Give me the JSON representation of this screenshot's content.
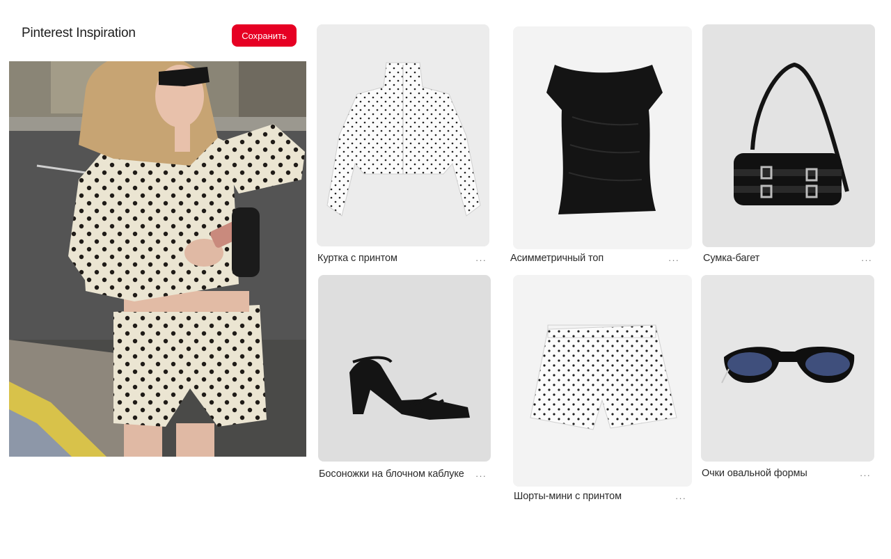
{
  "header": {
    "title": "Pinterest Inspiration",
    "save_label": "Сохранить"
  },
  "colors": {
    "accent": "#e60023",
    "card_bg_light": "#f3f3f3",
    "card_bg_grey": "#e4e4e4"
  },
  "hero": {
    "alt": "Look: polka dot jacket and shorts"
  },
  "products": [
    {
      "label": "Куртка с принтом",
      "more": "···",
      "icon": "polka-dot-jacket"
    },
    {
      "label": "Асимметричный топ",
      "more": "···",
      "icon": "black-top"
    },
    {
      "label": "Сумка-багет",
      "more": "···",
      "icon": "black-baguette-bag"
    },
    {
      "label": "Босоножки на блочном каблуке",
      "more": "···",
      "icon": "block-heel-sandals"
    },
    {
      "label": "Шорты-мини с принтом",
      "more": "···",
      "icon": "polka-dot-shorts"
    },
    {
      "label": "Очки овальной формы",
      "more": "···",
      "icon": "oval-sunglasses"
    }
  ]
}
